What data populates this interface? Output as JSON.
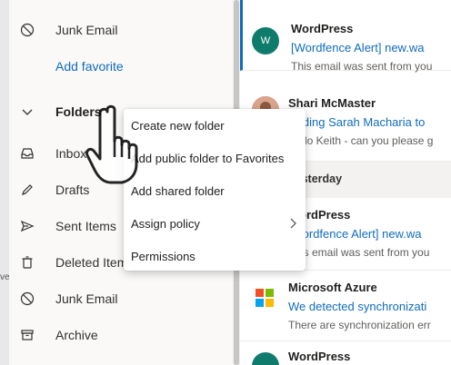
{
  "sidebar": {
    "items": [
      {
        "label": "Junk Email",
        "icon": "block-icon"
      },
      {
        "label": "Add favorite",
        "icon": ""
      },
      {
        "label": "Folders",
        "icon": "chevron-down-icon"
      },
      {
        "label": "Inbox",
        "icon": "inbox-icon"
      },
      {
        "label": "Drafts",
        "icon": "pencil-icon"
      },
      {
        "label": "Sent Items",
        "icon": "send-icon"
      },
      {
        "label": "Deleted Items",
        "icon": "trash-icon"
      },
      {
        "label": "Junk Email",
        "icon": "block-icon"
      },
      {
        "label": "Archive",
        "icon": "archive-icon"
      }
    ]
  },
  "messages": [
    {
      "sender": "WordPress",
      "subject": "[Wordfence Alert] new.wa",
      "preview": "This email was sent from you",
      "avatar": "W",
      "avatar_color": "#0f7b6c"
    },
    {
      "sender": "Shari McMaster",
      "subject": "Adding Sarah Macharia to",
      "preview": "Hello Keith - can you please g",
      "avatar": "",
      "avatar_color": "#c28b6b"
    },
    {
      "sender": "WordPress",
      "subject": "[Wordfence Alert] new.wa",
      "preview": "This email was sent from you",
      "avatar": "",
      "avatar_color": "#0f7b6c"
    },
    {
      "sender": "Microsoft Azure",
      "subject": "We detected synchronizati",
      "preview": "There are synchronization err",
      "avatar": "",
      "avatar_color": ""
    },
    {
      "sender": "WordPress",
      "subject": "",
      "preview": "",
      "avatar": "",
      "avatar_color": "#0f7b6c"
    }
  ],
  "group_header": "Yesterday",
  "context_menu": {
    "items": [
      {
        "label": "Create new folder"
      },
      {
        "label": "Add public folder to Favorites"
      },
      {
        "label": "Add shared folder"
      },
      {
        "label": "Assign policy",
        "submenu": true
      },
      {
        "label": "Permissions"
      }
    ]
  },
  "left_strip_mark": "ve",
  "colors": {
    "accent": "#0f6cbd",
    "sidebar_bg": "#faf9f8"
  }
}
